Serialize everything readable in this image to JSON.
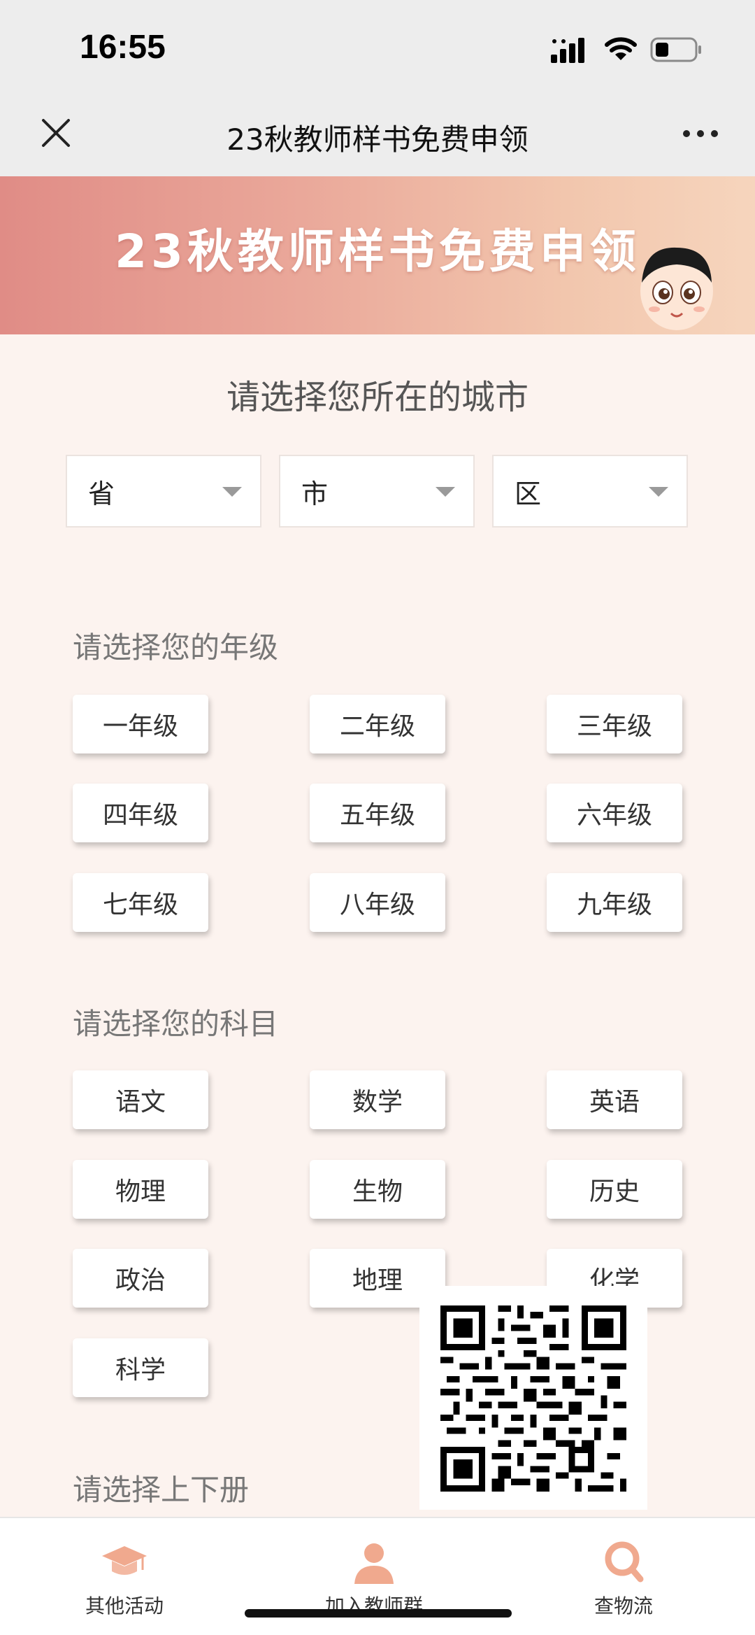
{
  "status_bar": {
    "time": "16:55"
  },
  "nav": {
    "title": "23秋教师样书免费申领"
  },
  "banner": {
    "title": "23秋教师样书免费申领"
  },
  "city": {
    "heading": "请选择您所在的城市",
    "selects": [
      {
        "value": "省"
      },
      {
        "value": "市"
      },
      {
        "value": "区"
      }
    ]
  },
  "grade": {
    "label": "请选择您的年级",
    "options": [
      "一年级",
      "二年级",
      "三年级",
      "四年级",
      "五年级",
      "六年级",
      "七年级",
      "八年级",
      "九年级"
    ]
  },
  "subject": {
    "label": "请选择您的科目",
    "options": [
      "语文",
      "数学",
      "英语",
      "物理",
      "生物",
      "历史",
      "政治",
      "地理",
      "化学",
      "科学"
    ]
  },
  "volume": {
    "label": "请选择上下册"
  },
  "bottom_nav": {
    "tabs": [
      {
        "label": "其他活动",
        "icon": "graduation-cap-icon"
      },
      {
        "label": "加入教师群",
        "icon": "person-icon"
      },
      {
        "label": "查物流",
        "icon": "magnifier-icon"
      }
    ]
  },
  "colors": {
    "accent": "#e89a8f",
    "background": "#fcf3ef",
    "icon": "#f0a98e"
  }
}
